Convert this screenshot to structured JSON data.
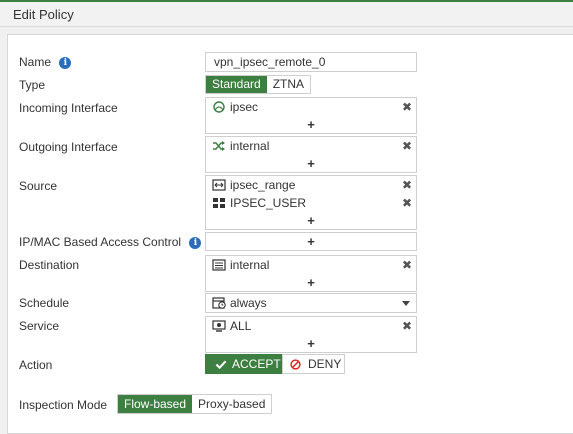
{
  "dialog": {
    "title": "Edit Policy"
  },
  "name": {
    "label": "Name",
    "value": "vpn_ipsec_remote_0"
  },
  "type": {
    "label": "Type",
    "options": [
      "Standard",
      "ZTNA"
    ],
    "selected": "Standard"
  },
  "incoming_interface": {
    "label": "Incoming Interface",
    "entries": [
      {
        "icon": "tunnel-icon",
        "text": "ipsec"
      }
    ],
    "add_symbol": "+",
    "remove_symbol": "✖"
  },
  "outgoing_interface": {
    "label": "Outgoing Interface",
    "entries": [
      {
        "icon": "shuffle-icon",
        "text": "internal"
      }
    ],
    "add_symbol": "+",
    "remove_symbol": "✖"
  },
  "source": {
    "label": "Source",
    "entries": [
      {
        "icon": "address-range-icon",
        "text": "ipsec_range"
      },
      {
        "icon": "user-group-icon",
        "text": "IPSEC_USER"
      }
    ],
    "add_symbol": "+",
    "remove_symbol": "✖"
  },
  "ip_mac_access": {
    "label": "IP/MAC Based Access Control",
    "add_symbol": "+"
  },
  "destination": {
    "label": "Destination",
    "entries": [
      {
        "icon": "address-icon",
        "text": "internal"
      }
    ],
    "add_symbol": "+",
    "remove_symbol": "✖"
  },
  "schedule": {
    "label": "Schedule",
    "value": "always",
    "icon": "schedule-icon"
  },
  "service": {
    "label": "Service",
    "entries": [
      {
        "icon": "service-icon",
        "text": "ALL"
      }
    ],
    "add_symbol": "+",
    "remove_symbol": "✖"
  },
  "action": {
    "label": "Action",
    "accept_label": "ACCEPT",
    "deny_label": "DENY",
    "selected": "ACCEPT"
  },
  "inspection_mode": {
    "label": "Inspection Mode",
    "options": [
      "Flow-based",
      "Proxy-based"
    ],
    "selected": "Flow-based"
  },
  "colors": {
    "accent": "#3d7f41",
    "info": "#2a6ebb",
    "deny": "#d9292b"
  }
}
